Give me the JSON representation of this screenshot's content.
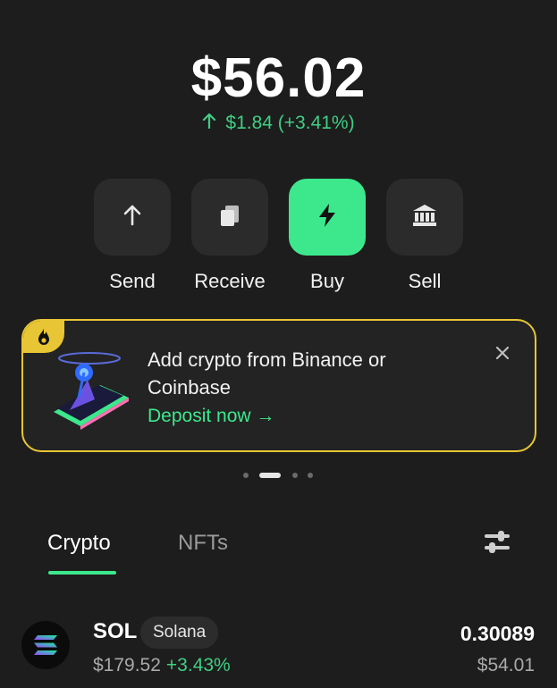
{
  "balance": {
    "amount": "$56.02",
    "change": "$1.84 (+3.41%)"
  },
  "actions": [
    {
      "label": "Send",
      "icon": "arrow-up-icon"
    },
    {
      "label": "Receive",
      "icon": "copy-icon"
    },
    {
      "label": "Buy",
      "icon": "lightning-icon"
    },
    {
      "label": "Sell",
      "icon": "bank-icon"
    }
  ],
  "banner": {
    "title": "Add crypto from Binance or Coinbase",
    "cta": "Deposit now →",
    "icon": "fire-icon",
    "close_icon": "close-icon"
  },
  "carousel": {
    "count": 4,
    "active": 1
  },
  "tabs": {
    "crypto": "Crypto",
    "nfts": "NFTs",
    "active": "Crypto"
  },
  "tokens": [
    {
      "symbol": "SOL",
      "name": "Solana",
      "price": "$179.52",
      "change": "+3.43%",
      "amount": "0.30089",
      "value": "$54.01"
    }
  ],
  "colors": {
    "accent": "#3de88c",
    "positive": "#3fcf83",
    "banner_border": "#e8c534",
    "background": "#1d1d1d"
  }
}
